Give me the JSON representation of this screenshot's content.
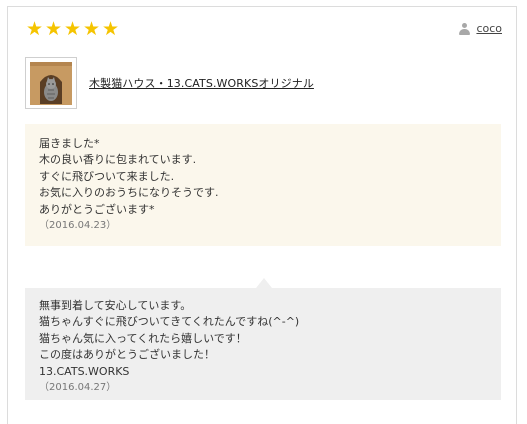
{
  "rating": {
    "value": 5,
    "max": 5,
    "stars": [
      "★",
      "★",
      "★",
      "★",
      "★"
    ],
    "color": "#f5c400"
  },
  "user": {
    "icon": "user-icon",
    "name": "coco"
  },
  "product": {
    "thumbnail": "cat-house-thumbnail",
    "name": "木製猫ハウス・13.CATS.WORKSオリジナル"
  },
  "review": {
    "lines": [
      "届きました*",
      "木の良い香りに包まれています.",
      "すぐに飛びついて来ました.",
      "お気に入りのおうちになりそうです.",
      "ありがとうございます*"
    ],
    "date": "（2016.04.23）",
    "background": "#fbf7ec"
  },
  "reply": {
    "lines": [
      "無事到着して安心しています。",
      "猫ちゃんすぐに飛びついてきてくれたんですね(^-^)",
      "猫ちゃん気に入ってくれたら嬉しいです！",
      "この度はありがとうございました！",
      "13.CATS.WORKS"
    ],
    "date": "（2016.04.27）",
    "background": "#efefef"
  }
}
